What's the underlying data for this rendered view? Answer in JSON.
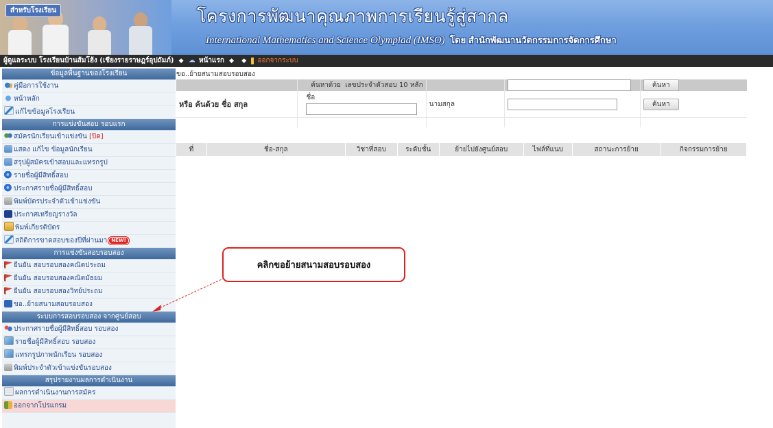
{
  "header": {
    "for_school": "สำหรับโรงเรียน",
    "title_th": "โครงการพัฒนาคุณภาพการเรียนรู้สู่สากล",
    "title_en": "International Mathematics and Science Olympiad (IMSO)",
    "title_org": "โดย สำนักพัฒนานวัตกรรมการจัดการศึกษา"
  },
  "topbar": {
    "user": "ผู้ดูแลระบบ โรงเรียนบ้านส้มโฮ้ง (เชียงรายราษฎร์อุปถัมภ์)",
    "home": "หน้าแรก",
    "exit": "ออกจากระบบ"
  },
  "sidebar": {
    "sections": [
      {
        "title": "ข้อมูลพื้นฐานของโรงเรียน",
        "items": [
          {
            "label": "คู่มือการใช้งาน",
            "icon": "manual-icon"
          },
          {
            "label": "หน้าหลัก",
            "icon": "home-icon"
          },
          {
            "label": "แก้ไขข้อมูลโรงเรียน",
            "icon": "edit-icon"
          }
        ]
      },
      {
        "title": "การแข่งขันสอบ รอบแรก",
        "items": [
          {
            "label": "สมัครนักเรียนเข้าแข่งขัน",
            "extra": "[ปิด]",
            "icon": "students-icon"
          },
          {
            "label": "แสดง แก้ไข ข้อมูลนักเรียน",
            "icon": "card-icon"
          },
          {
            "label": "สรุปผู้สมัครเข้าสอบและแทรกรูป",
            "icon": "card-icon"
          },
          {
            "label": "รายชื่อผู้มีสิทธิ์สอบ",
            "icon": "globe-icon"
          },
          {
            "label": "ประกาศรายชื่อผู้มีสิทธิ์สอบ",
            "icon": "globe-icon"
          },
          {
            "label": "พิมพ์บัตรประจำตัวเข้าแข่งขัน",
            "icon": "print-icon"
          },
          {
            "label": "ประกาศเหรียญรางวัล",
            "icon": "award-icon"
          },
          {
            "label": "พิมพ์เกียรติบัตร",
            "icon": "certificate-icon"
          },
          {
            "label": "สถิติการขาดสอบของปีที่ผ่านมา",
            "badge": "NEW!",
            "icon": "edit-icon"
          }
        ]
      },
      {
        "title": "การแข่งขันสอบรอบสอง",
        "items": [
          {
            "label": "ยืนยัน สอบรอบสองคณิตประถม",
            "icon": "flag-icon"
          },
          {
            "label": "ยืนยัน สอบรอบสองคณิตมัธยม",
            "icon": "flag-icon"
          },
          {
            "label": "ยืนยัน สอบรอบสองวิทย์ประถม",
            "icon": "flag-icon"
          },
          {
            "label": "ขอ..ย้ายสนามสอบรอบสอง",
            "icon": "move-icon"
          }
        ]
      },
      {
        "title": "ระบบการสอบรอบสอง จากศูนย์สอบ",
        "items": [
          {
            "label": "ประกาศรายชื่อผู้มีสิทธิ์สอบ รอบสอง",
            "icon": "group-icon"
          },
          {
            "label": "รายชื่อผู้มีสิทธิ์สอบ รอบสอง",
            "icon": "image-icon"
          },
          {
            "label": "แทรกรูปภาพนักเรียน รอบสอง",
            "icon": "image-icon"
          },
          {
            "label": "พิมพ์ประจำตัวเข้าแข่งขันรอบสอง",
            "icon": "print-icon"
          }
        ]
      },
      {
        "title": "สรุปรายงานผลการดำเนินงาน",
        "items": [
          {
            "label": "ผลการดำเนินงานการสมัคร",
            "icon": "document-icon"
          },
          {
            "label": "ออกจากโปรแกรม",
            "icon": "exit-icon"
          }
        ]
      }
    ]
  },
  "main": {
    "breadcrumb": "ขอ..ย้ายสนามสอบรอบสอง",
    "search_by": "ค้นหาด้วย",
    "id_label": "เลขประจำตัวสอบ 10 หลัก",
    "or_search": "หรือ ค้นด้วย ชื่อ สกุล",
    "first_name": "ชื่อ",
    "last_name": "นามสกุล",
    "search_button": "ค้นหา",
    "columns": [
      "ที่",
      "ชื่อ-สกุล",
      "วิชาที่สอบ",
      "ระดับชั้น",
      "ย้ายไปยังศูนย์สอบ",
      "ไฟล์ที่แนบ",
      "สถานะการย้าย",
      "กิจกรรมการย้าย"
    ]
  },
  "callout": {
    "text": "คลิกขอย้ายสนามสอบรอบสอง"
  },
  "colors": {
    "section_header": "#4f78a8",
    "menu_text": "#2a4f8f",
    "callout_border": "#e02020",
    "topbar": "#2b2b2b"
  }
}
